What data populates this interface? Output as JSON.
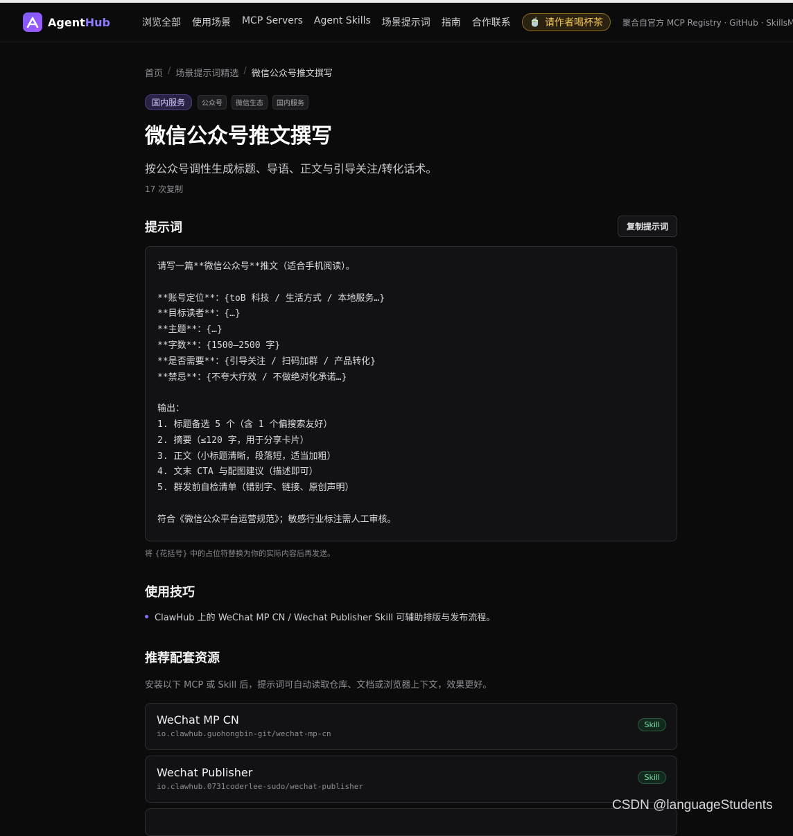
{
  "header": {
    "logo_main": "Agent",
    "logo_accent": "Hub",
    "nav": [
      "浏览全部",
      "使用场景",
      "MCP Servers",
      "Agent Skills",
      "场景提示词",
      "指南",
      "合作联系"
    ],
    "tea_icon": "🍵",
    "tea_label": "请作者喝杯茶",
    "note": "聚合自官方 MCP Registry · GitHub · SkillsMP"
  },
  "breadcrumb": {
    "home": "首页",
    "sep": "/",
    "section": "场景提示词精选",
    "current": "微信公众号推文撰写"
  },
  "tags": {
    "main": "国内服务",
    "items": [
      "公众号",
      "微信生态",
      "国内服务"
    ]
  },
  "page": {
    "title": "微信公众号推文撰写",
    "subtitle": "按公众号调性生成标题、导语、正文与引导关注/转化话术。",
    "copies": "17 次复制"
  },
  "prompt_section": {
    "heading": "提示词",
    "copy_button": "复制提示词",
    "text": "请写一篇**微信公众号**推文（适合手机阅读）。\n\n**账号定位**：{toB 科技 / 生活方式 / 本地服务…}\n**目标读者**：{…}\n**主题**：{…}\n**字数**：{1500–2500 字}\n**是否需要**：{引导关注 / 扫码加群 / 产品转化}\n**禁忌**：{不夸大疗效 / 不做绝对化承诺…}\n\n输出：\n1. 标题备选 5 个（含 1 个偏搜索友好）\n2. 摘要（≤120 字，用于分享卡片）\n3. 正文（小标题清晰，段落短，适当加粗）\n4. 文末 CTA 与配图建议（描述即可）\n5. 群发前自检清单（错别字、链接、原创声明）\n\n符合《微信公众平台运营规范》；敏感行业标注需人工审核。",
    "hint": "将 {花括号} 中的占位符替换为你的实际内容后再发送。"
  },
  "tips_section": {
    "heading": "使用技巧",
    "items": [
      "ClawHub 上的 WeChat MP CN / Wechat Publisher Skill 可辅助排版与发布流程。"
    ]
  },
  "resources": {
    "heading": "推荐配套资源",
    "description": "安装以下 MCP 或 Skill 后，提示词可自动读取仓库、文档或浏览器上下文，效果更好。",
    "items": [
      {
        "name": "WeChat MP CN",
        "id": "io.clawhub.guohongbin-git/wechat-mp-cn",
        "badge": "Skill"
      },
      {
        "name": "Wechat Publisher",
        "id": "io.clawhub.0731coderlee-sudo/wechat-publisher",
        "badge": "Skill"
      }
    ]
  },
  "watermark": "CSDN @languageStudents"
}
